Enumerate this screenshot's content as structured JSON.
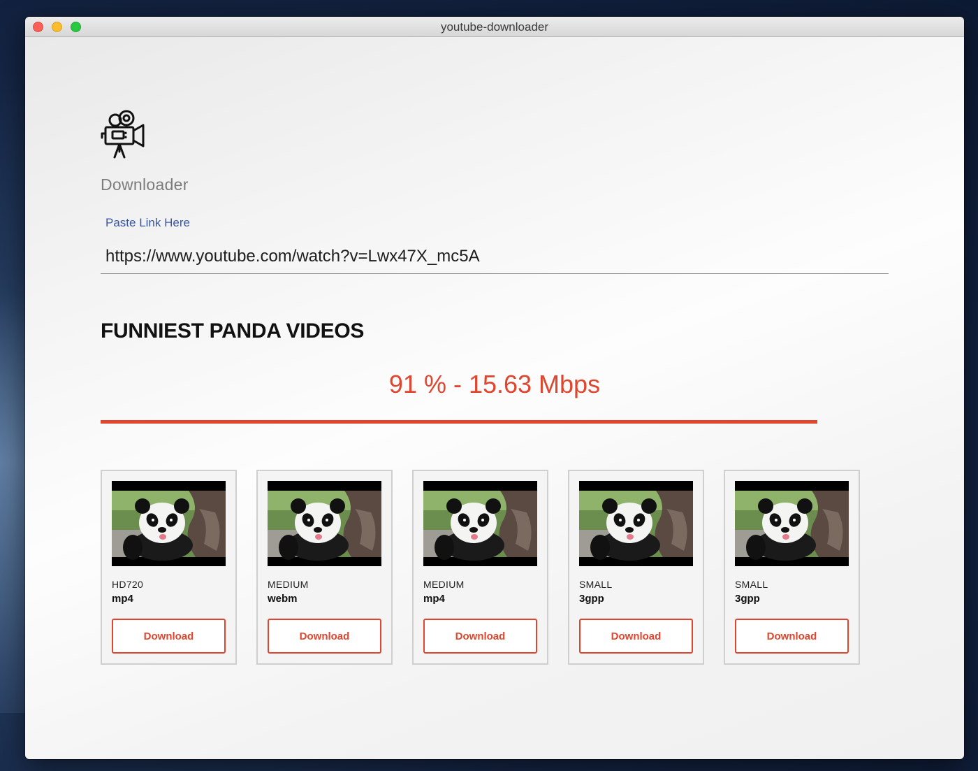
{
  "window": {
    "title": "youtube-downloader"
  },
  "app": {
    "name": "Downloader",
    "logo_icon": "video-camera-icon"
  },
  "link_field": {
    "label": "Paste Link Here",
    "value": "https://www.youtube.com/watch?v=Lwx47X_mc5A",
    "placeholder": "Paste Link Here"
  },
  "video": {
    "title": "FUNNIEST PANDA VIDEOS"
  },
  "progress": {
    "text": "91 % - 15.63 Mbps",
    "percent": 91,
    "color": "#e0452e"
  },
  "formats": [
    {
      "quality": "HD720",
      "format": "mp4",
      "button_label": "Download",
      "thumbnail": "panda-thumbnail"
    },
    {
      "quality": "MEDIUM",
      "format": "webm",
      "button_label": "Download",
      "thumbnail": "panda-thumbnail"
    },
    {
      "quality": "MEDIUM",
      "format": "mp4",
      "button_label": "Download",
      "thumbnail": "panda-thumbnail"
    },
    {
      "quality": "SMALL",
      "format": "3gpp",
      "button_label": "Download",
      "thumbnail": "panda-thumbnail"
    },
    {
      "quality": "SMALL",
      "format": "3gpp",
      "button_label": "Download",
      "thumbnail": "panda-thumbnail"
    }
  ]
}
